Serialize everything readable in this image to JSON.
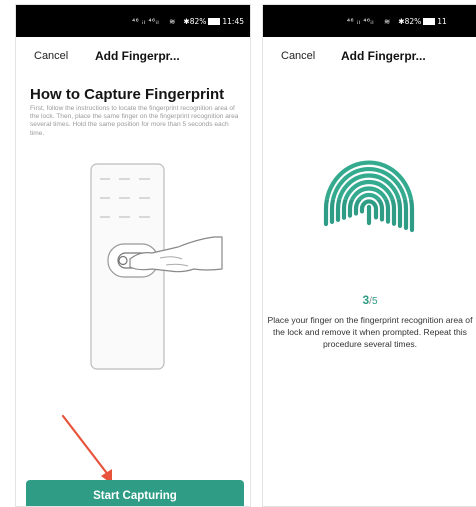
{
  "left_screen": {
    "status_bar": {
      "signal": "⁴⁶ ᵢₗ ⁴⁶ᵢₗ",
      "wifi": "≋",
      "battery_text": "82%",
      "bluetooth": "✱",
      "time": "11:45"
    },
    "cancel_label": "Cancel",
    "title": "Add Fingerpr...",
    "heading": "How to Capture Fingerprint",
    "instructions": "First, follow the instructions to locate the fingerprint recognition area of the lock. Then, place the same finger on the fingerprint recognition area several times. Hold the same position for more than 5 seconds each time.",
    "start_button_label": "Start Capturing"
  },
  "right_screen": {
    "status_bar": {
      "signal": "⁴⁶ ᵢₗ ⁴⁶ᵢₗ",
      "wifi": "≋",
      "battery_text": "82%",
      "bluetooth": "✱",
      "time": "11"
    },
    "cancel_label": "Cancel",
    "title": "Add Fingerpr...",
    "progress": {
      "current": "3",
      "separator": "/",
      "total": "5",
      "fraction": 0.6
    },
    "instruction": "Place your finger on the fingerprint recognition area of the lock and remove it when prompted. Repeat this procedure several times."
  },
  "colors": {
    "accent": "#2f9c86",
    "arrow": "#e8533c",
    "status_bar": "#000000"
  }
}
